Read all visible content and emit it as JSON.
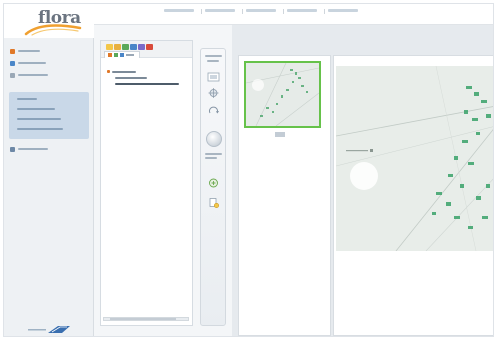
{
  "app": {
    "logo_text": "flora"
  },
  "colors": {
    "accent": "#e07828",
    "selection_border": "#66c24a",
    "sidebar_group_bg": "#c9d8e8",
    "map_green": "#3aa36a"
  },
  "top_nav": {
    "items": [
      {
        "label": "",
        "icon": ""
      },
      {
        "label": "",
        "icon": ""
      },
      {
        "label": "",
        "icon": ""
      },
      {
        "label": "",
        "icon": ""
      },
      {
        "label": "",
        "icon": ""
      }
    ]
  },
  "sidebar": {
    "items": [
      {
        "label": "",
        "icon": "home-icon"
      },
      {
        "label": "",
        "icon": "folder-icon"
      },
      {
        "label": "",
        "icon": "edit-icon"
      }
    ],
    "group": [
      {
        "label": ""
      },
      {
        "label": ""
      },
      {
        "label": ""
      },
      {
        "label": ""
      }
    ],
    "extra": {
      "label": "",
      "icon": "settings-icon"
    }
  },
  "tree": {
    "tab_label": "",
    "nodes": [
      {
        "label": "",
        "level": 0
      },
      {
        "label": "",
        "level": 1
      },
      {
        "label": "",
        "level": 1
      }
    ]
  },
  "viewer": {
    "thumbnail_caption": "",
    "tools": [
      {
        "label": "",
        "icon": "select-icon"
      },
      {
        "label": "",
        "icon": "pan-icon"
      },
      {
        "label": "",
        "icon": "rotate-icon"
      },
      {
        "label": "",
        "icon": "zoom-icon"
      },
      {
        "label": "",
        "icon": "fit-icon"
      },
      {
        "label": "",
        "icon": "print-icon"
      }
    ]
  }
}
